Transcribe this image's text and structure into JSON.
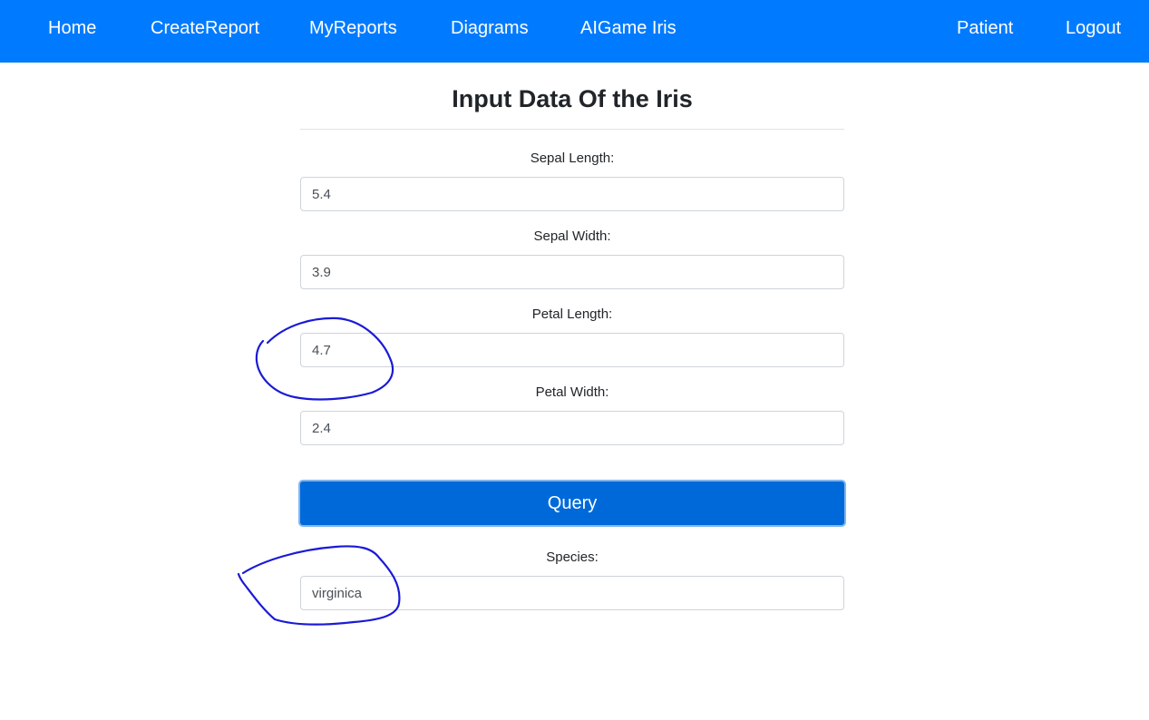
{
  "nav": {
    "home": "Home",
    "create_report": "CreateReport",
    "my_reports": "MyReports",
    "diagrams": "Diagrams",
    "aigame_iris": "AIGame Iris",
    "patient": "Patient",
    "logout": "Logout"
  },
  "form": {
    "title": "Input Data Of the Iris",
    "sepal_length": {
      "label": "Sepal Length:",
      "value": "5.4"
    },
    "sepal_width": {
      "label": "Sepal Width:",
      "value": "3.9"
    },
    "petal_length": {
      "label": "Petal Length:",
      "value": "4.7"
    },
    "petal_width": {
      "label": "Petal Width:",
      "value": "2.4"
    },
    "query_label": "Query",
    "species": {
      "label": "Species:",
      "value": "virginica"
    }
  },
  "colors": {
    "navbar": "#007bff",
    "button": "#0069d9",
    "annotation_ink": "#1a1ad6"
  }
}
